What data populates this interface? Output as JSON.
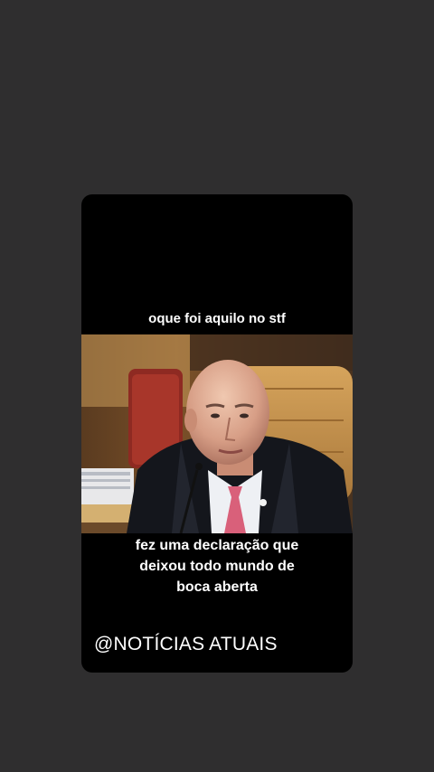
{
  "post": {
    "caption_top": "oque foi aquilo no stf",
    "caption_bottom_lines": [
      "fez uma declaração que",
      "deixou todo mundo de",
      "boca aberta"
    ],
    "watermark": "@NOTÍCIAS ATUAIS"
  },
  "colors": {
    "page_background": "#2f2e2f",
    "card_background": "#000000",
    "caption_text": "#ffffff",
    "robe": "#14161c",
    "tie": "#d9607a",
    "chair_leather": "#c8934a"
  }
}
